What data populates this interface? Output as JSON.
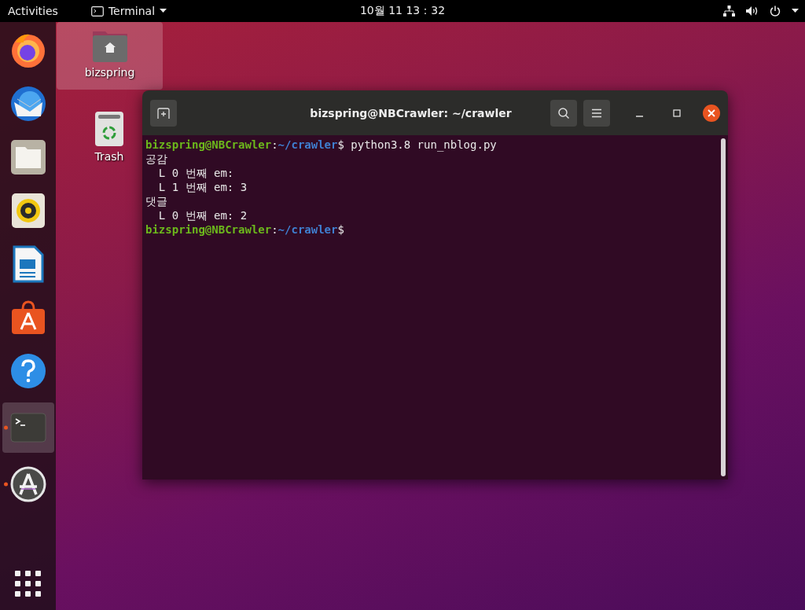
{
  "top_bar": {
    "activities": "Activities",
    "app_menu": "Terminal",
    "clock": "10월 11  13：32"
  },
  "dock": {
    "items": [
      {
        "kind": "firefox",
        "selected": false,
        "running": false
      },
      {
        "kind": "thunderbird",
        "selected": false,
        "running": false
      },
      {
        "kind": "files",
        "selected": false,
        "running": false
      },
      {
        "kind": "rhythmbox",
        "selected": false,
        "running": false
      },
      {
        "kind": "writer",
        "selected": false,
        "running": false
      },
      {
        "kind": "software",
        "selected": false,
        "running": false
      },
      {
        "kind": "help",
        "selected": false,
        "running": false
      },
      {
        "kind": "terminal",
        "selected": true,
        "running": true
      },
      {
        "kind": "updater",
        "selected": false,
        "running": true
      }
    ]
  },
  "desktop_icons": [
    {
      "kind": "home",
      "label": "bizspring",
      "selected": true
    },
    {
      "kind": "trash",
      "label": "Trash",
      "selected": false
    }
  ],
  "terminal_window": {
    "title": "bizspring@NBCrawler: ~/crawler",
    "lines": [
      {
        "segments": [
          {
            "kind": "user",
            "text": "bizspring@NBCrawler"
          },
          {
            "kind": "plain",
            "text": ":"
          },
          {
            "kind": "path",
            "text": "~/crawler"
          },
          {
            "kind": "plain",
            "text": "$ python3.8 run_nblog.py"
          }
        ]
      },
      {
        "segments": [
          {
            "kind": "plain",
            "text": "공감"
          }
        ]
      },
      {
        "segments": [
          {
            "kind": "plain",
            "text": "  L 0 번째 em:"
          }
        ]
      },
      {
        "segments": [
          {
            "kind": "plain",
            "text": "  L 1 번째 em: 3"
          }
        ]
      },
      {
        "segments": [
          {
            "kind": "plain",
            "text": "댓글"
          }
        ]
      },
      {
        "segments": [
          {
            "kind": "plain",
            "text": "  L 0 번째 em: 2"
          }
        ]
      },
      {
        "segments": [
          {
            "kind": "user",
            "text": "bizspring@NBCrawler"
          },
          {
            "kind": "plain",
            "text": ":"
          },
          {
            "kind": "path",
            "text": "~/crawler"
          },
          {
            "kind": "plain",
            "text": "$"
          }
        ]
      }
    ]
  }
}
